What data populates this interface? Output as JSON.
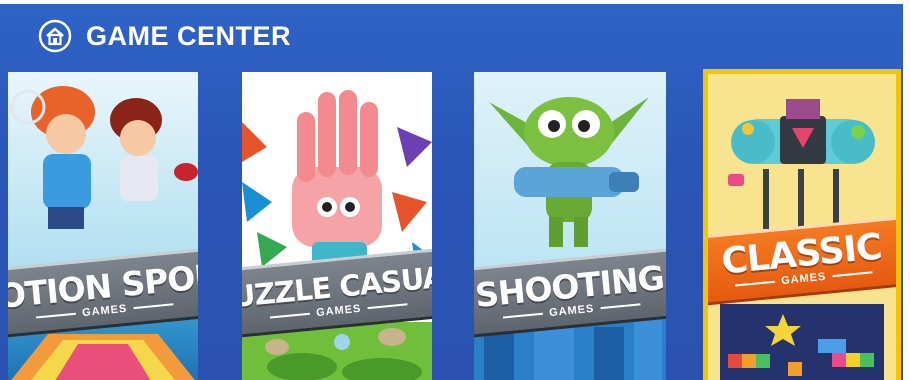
{
  "header": {
    "title": "GAME CENTER",
    "icon": "home-icon"
  },
  "cards": [
    {
      "title": "MOTION SPORT",
      "subtitle": "GAMES",
      "banner_color": "#6b737b"
    },
    {
      "title": "PUZZLE CASUAL",
      "subtitle": "GAMES",
      "banner_color": "#6b737b"
    },
    {
      "title": "SHOOTING",
      "subtitle": "GAMES",
      "banner_color": "#6b737b"
    },
    {
      "title": "CLASSIC",
      "subtitle": "GAMES",
      "banner_color": "#ef6a18",
      "selected": true
    }
  ],
  "colors": {
    "background": "#2b56b8",
    "selection_border": "#f5c400"
  }
}
